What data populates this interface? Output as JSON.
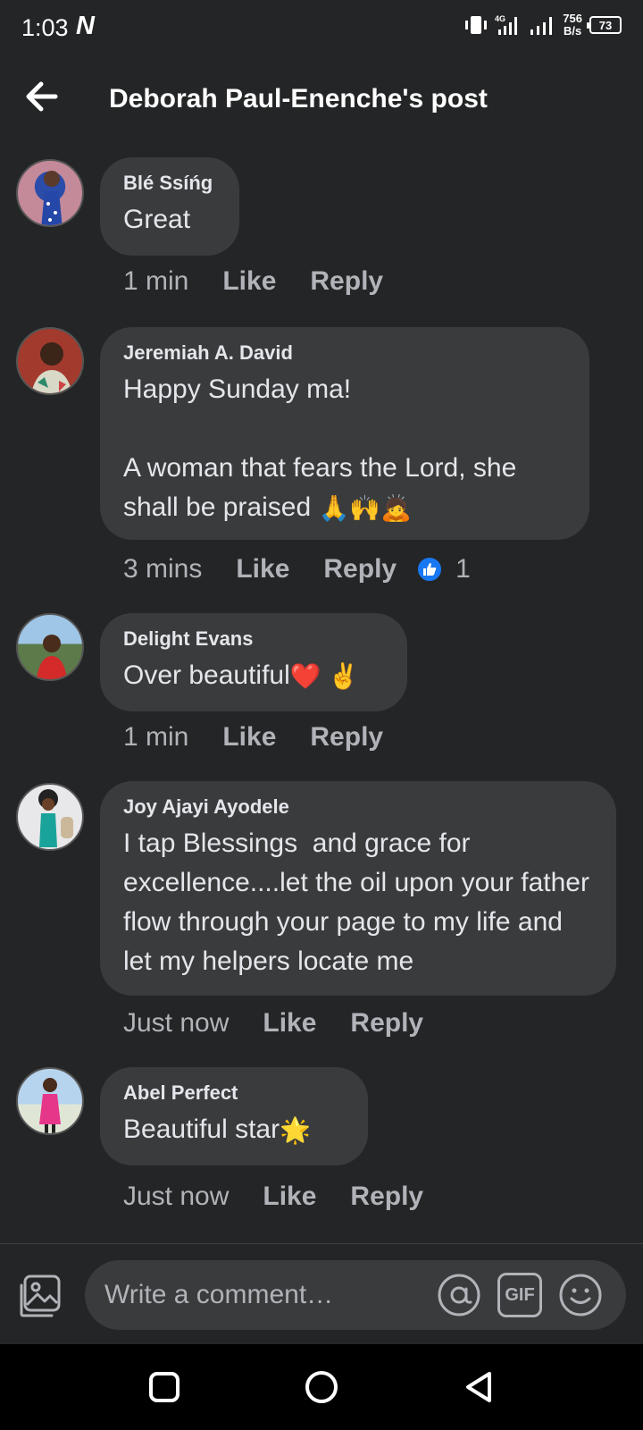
{
  "status_bar": {
    "time": "1:03",
    "network_badge": "N",
    "network_type": "4G",
    "speed_value": "756",
    "speed_unit": "B/s",
    "battery": "73"
  },
  "header": {
    "back_icon": "arrow-left-icon",
    "title": "Deborah Paul-Enenche's post"
  },
  "comments": [
    {
      "author": "Blé Ssíńg",
      "text": "Great",
      "time": "1 min",
      "like_label": "Like",
      "reply_label": "Reply"
    },
    {
      "author": "Jeremiah A. David",
      "text": "Happy Sunday ma!\n\nA woman that fears the Lord, she shall be praised ",
      "emojis": "🙏🙌🙇",
      "time": "3 mins",
      "like_label": "Like",
      "reply_label": "Reply",
      "reaction_count": "1"
    },
    {
      "author": "Delight Evans",
      "text": "Over beautiful",
      "emojis": "❤️ ✌️",
      "time": "1 min",
      "like_label": "Like",
      "reply_label": "Reply"
    },
    {
      "author": "Joy Ajayi Ayodele",
      "text": "I tap Blessings  and grace for excellence....let the oil upon your father flow through your page to my life and let my helpers locate me",
      "time": "Just now",
      "like_label": "Like",
      "reply_label": "Reply"
    },
    {
      "author": "Abel Perfect",
      "text": "Beautiful star",
      "emojis": "🌟",
      "time": "Just now",
      "like_label": "Like",
      "reply_label": "Reply"
    }
  ],
  "composer": {
    "placeholder": "Write a comment…",
    "photo_icon": "photo-icon",
    "mention_icon": "at-sign-icon",
    "gif_label": "GIF",
    "emoji_icon": "smiley-icon"
  },
  "colors": {
    "background": "#242526",
    "bubble": "#3a3b3c",
    "text": "#e4e6eb",
    "secondary_text": "#b0b3b8",
    "like_blue": "#1877f2"
  }
}
